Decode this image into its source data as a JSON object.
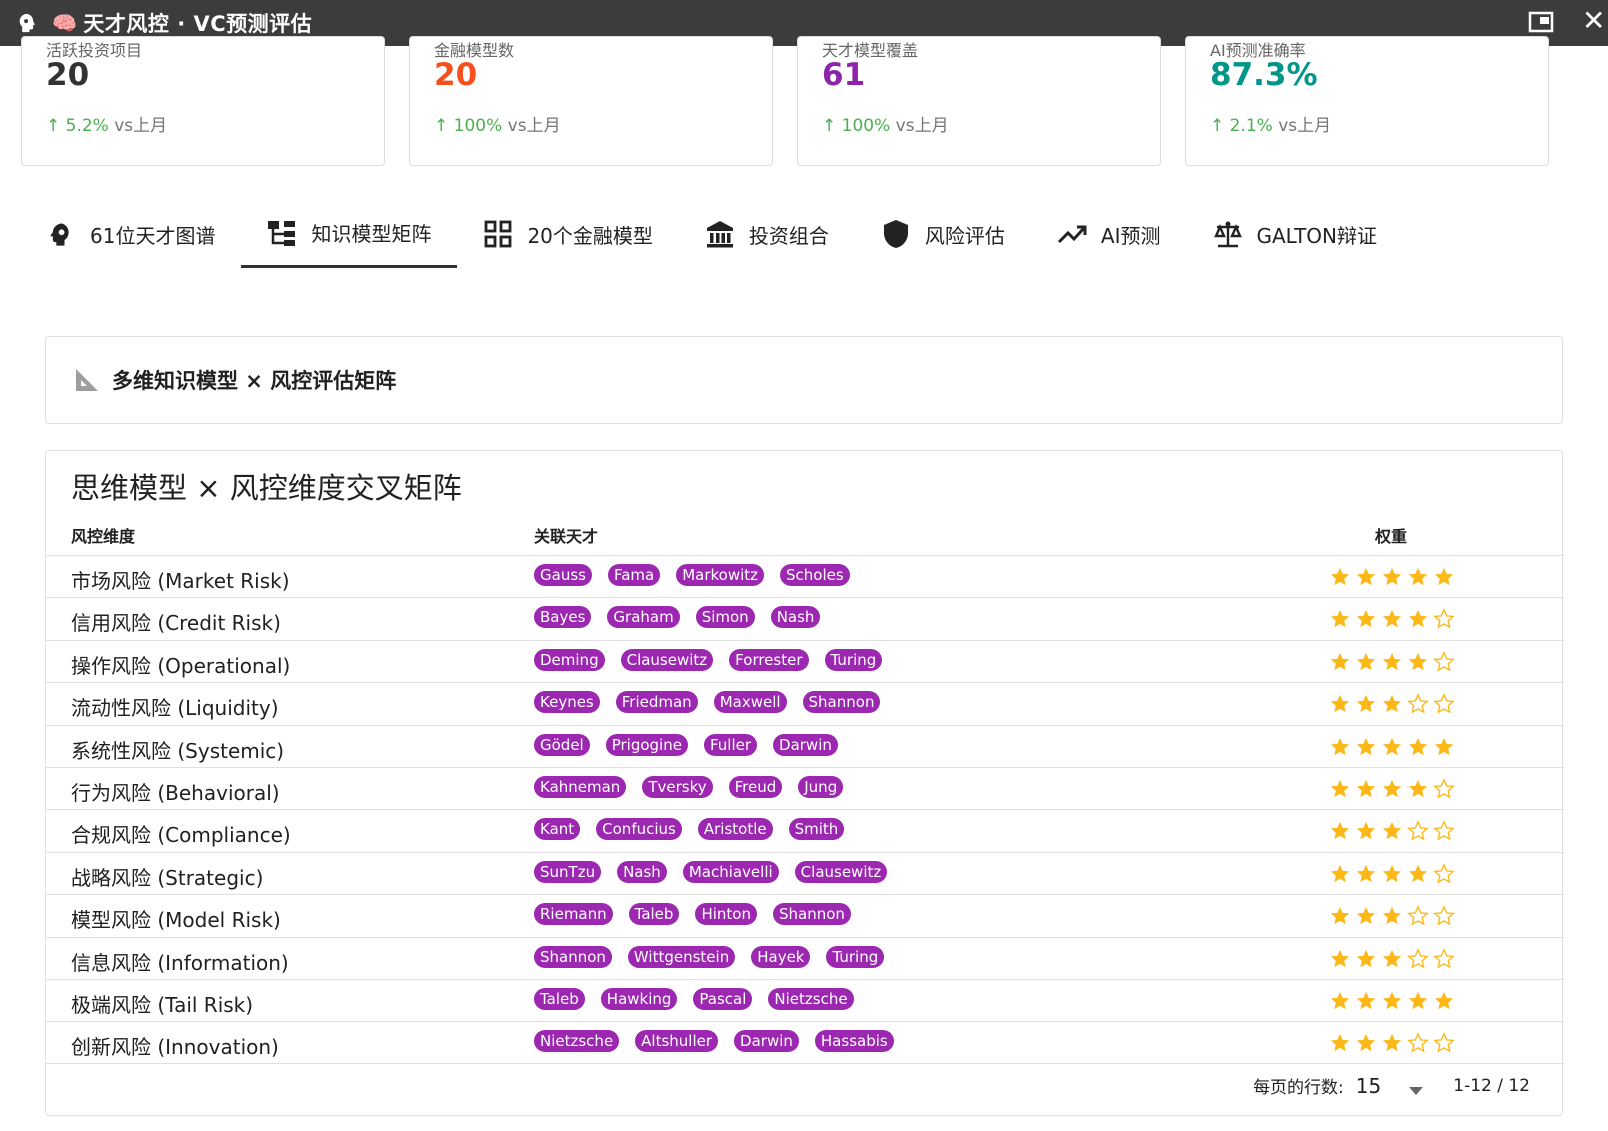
{
  "window": {
    "title": "天才风控 · VC预测评估",
    "emoji": "🧠"
  },
  "stats": [
    {
      "label": "活跃投资项目",
      "value": "20",
      "color": "#333333",
      "change": "↑ 5.2%",
      "vs": " vs上月"
    },
    {
      "label": "金融模型数",
      "value": "20",
      "color": "#f4511e",
      "change": "↑ 100%",
      "vs": " vs上月"
    },
    {
      "label": "天才模型覆盖",
      "value": "61",
      "color": "#8e24aa",
      "change": "↑ 100%",
      "vs": " vs上月"
    },
    {
      "label": "AI预测准确率",
      "value": "87.3%",
      "color": "#009688",
      "change": "↑ 2.1%",
      "vs": " vs上月"
    }
  ],
  "tabs": [
    {
      "label": "61位天才图谱",
      "icon": "brain-icon"
    },
    {
      "label": "知识模型矩阵",
      "icon": "hierarchy-icon"
    },
    {
      "label": "20个金融模型",
      "icon": "grid-icon"
    },
    {
      "label": "投资组合",
      "icon": "bank-icon"
    },
    {
      "label": "风险评估",
      "icon": "shield-icon"
    },
    {
      "label": "AI预测",
      "icon": "trend-icon"
    },
    {
      "label": "GALTON辩证",
      "icon": "scale-icon"
    }
  ],
  "active_tab": 1,
  "panel": {
    "title": "多维知识模型 × 风控评估矩阵"
  },
  "matrix": {
    "title": "思维模型 × 风控维度交叉矩阵",
    "headers": {
      "dimension": "风控维度",
      "geniuses": "关联天才",
      "weight": "权重"
    },
    "rows": [
      {
        "dimension": "市场风险 (Market Risk)",
        "geniuses": [
          "Gauss",
          "Fama",
          "Markowitz",
          "Scholes"
        ],
        "weight": 5
      },
      {
        "dimension": "信用风险 (Credit Risk)",
        "geniuses": [
          "Bayes",
          "Graham",
          "Simon",
          "Nash"
        ],
        "weight": 4
      },
      {
        "dimension": "操作风险 (Operational)",
        "geniuses": [
          "Deming",
          "Clausewitz",
          "Forrester",
          "Turing"
        ],
        "weight": 4
      },
      {
        "dimension": "流动性风险 (Liquidity)",
        "geniuses": [
          "Keynes",
          "Friedman",
          "Maxwell",
          "Shannon"
        ],
        "weight": 3
      },
      {
        "dimension": "系统性风险 (Systemic)",
        "geniuses": [
          "Gödel",
          "Prigogine",
          "Fuller",
          "Darwin"
        ],
        "weight": 5
      },
      {
        "dimension": "行为风险 (Behavioral)",
        "geniuses": [
          "Kahneman",
          "Tversky",
          "Freud",
          "Jung"
        ],
        "weight": 4
      },
      {
        "dimension": "合规风险 (Compliance)",
        "geniuses": [
          "Kant",
          "Confucius",
          "Aristotle",
          "Smith"
        ],
        "weight": 3
      },
      {
        "dimension": "战略风险 (Strategic)",
        "geniuses": [
          "SunTzu",
          "Nash",
          "Machiavelli",
          "Clausewitz"
        ],
        "weight": 4
      },
      {
        "dimension": "模型风险 (Model Risk)",
        "geniuses": [
          "Riemann",
          "Taleb",
          "Hinton",
          "Shannon"
        ],
        "weight": 3
      },
      {
        "dimension": "信息风险 (Information)",
        "geniuses": [
          "Shannon",
          "Wittgenstein",
          "Hayek",
          "Turing"
        ],
        "weight": 3
      },
      {
        "dimension": "极端风险 (Tail Risk)",
        "geniuses": [
          "Taleb",
          "Hawking",
          "Pascal",
          "Nietzsche"
        ],
        "weight": 5
      },
      {
        "dimension": "创新风险 (Innovation)",
        "geniuses": [
          "Nietzsche",
          "Altshuller",
          "Darwin",
          "Hassabis"
        ],
        "weight": 3
      }
    ],
    "max_weight": 5
  },
  "pagination": {
    "rows_per_page_label": "每页的行数:",
    "rows_per_page": "15",
    "range": "1-12 / 12"
  },
  "colors": {
    "chip": "#9c27b0",
    "star_filled": "#fbb817",
    "star_empty": "#fbb817"
  }
}
